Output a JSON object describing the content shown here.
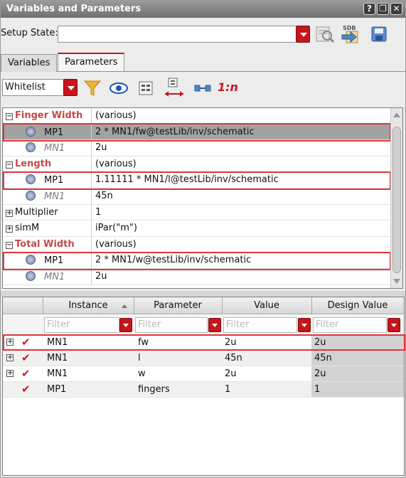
{
  "window": {
    "title": "Variables and Parameters"
  },
  "setup": {
    "label": "Setup State:",
    "value": "",
    "sdb_label": "SDB"
  },
  "tabs": [
    {
      "label": "Variables"
    },
    {
      "label": "Parameters"
    }
  ],
  "toolbar": {
    "mode": "Whitelist",
    "ratio_label": "1:n"
  },
  "tree": {
    "rows": [
      {
        "name": "Finger Width",
        "value": "(various)"
      },
      {
        "name": "MP1",
        "value": "2 * MN1/fw@testLib/inv/schematic"
      },
      {
        "name": "MN1",
        "value": "2u"
      },
      {
        "name": "Length",
        "value": "(various)"
      },
      {
        "name": "MP1",
        "value": "1.11111 * MN1/l@testLib/inv/schematic"
      },
      {
        "name": "MN1",
        "value": "45n"
      },
      {
        "name": "Multiplier",
        "value": "1"
      },
      {
        "name": "simM",
        "value": "iPar(\"m\")"
      },
      {
        "name": "Total Width",
        "value": "(various)"
      },
      {
        "name": "MP1",
        "value": "2 * MN1/w@testLib/inv/schematic"
      },
      {
        "name": "MN1",
        "value": "2u"
      }
    ]
  },
  "grid": {
    "columns": [
      "Instance",
      "Parameter",
      "Value",
      "Design Value"
    ],
    "filter_placeholder": "Filter",
    "rows": [
      {
        "instance": "MN1",
        "parameter": "fw",
        "value": "2u",
        "design_value": "2u"
      },
      {
        "instance": "MN1",
        "parameter": "l",
        "value": "45n",
        "design_value": "45n"
      },
      {
        "instance": "MN1",
        "parameter": "w",
        "value": "2u",
        "design_value": "2u"
      },
      {
        "instance": "MP1",
        "parameter": "fingers",
        "value": "1",
        "design_value": "1"
      }
    ]
  },
  "colors": {
    "accent_red": "#c8141b",
    "highlight_box": "#e3333a",
    "group_label": "#c44b47"
  }
}
